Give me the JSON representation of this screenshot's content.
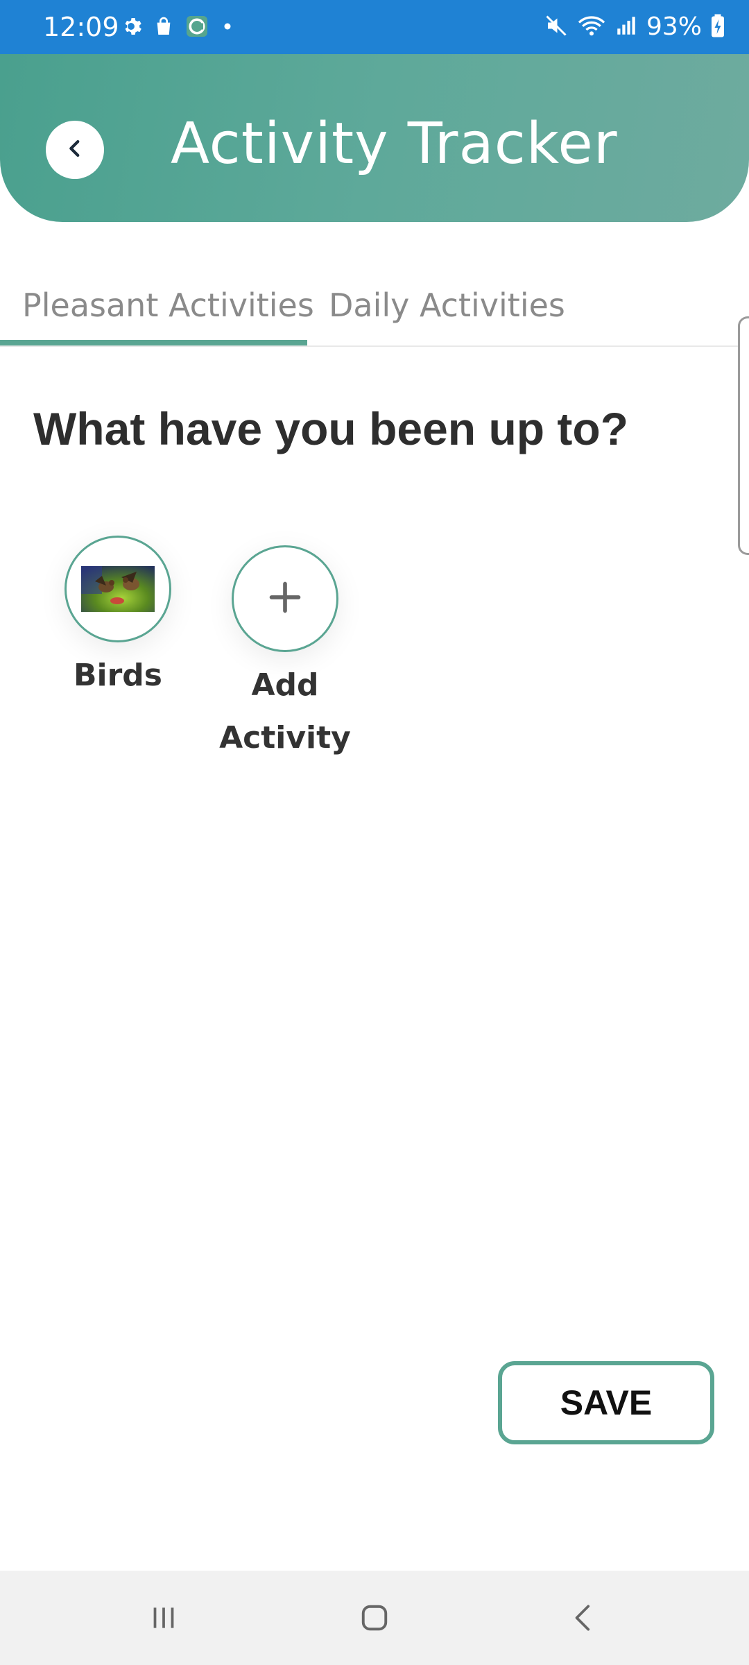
{
  "status_bar": {
    "time": "12:09",
    "battery": "93%",
    "icons": [
      "gear-icon",
      "bag-icon",
      "app-c-icon",
      "dot-icon",
      "mute-icon",
      "wifi-icon",
      "signal-icon",
      "battery-charging-icon"
    ]
  },
  "header": {
    "title": "Activity Tracker",
    "back_icon": "chevron-left-icon",
    "color": "#5aa592"
  },
  "tabs": [
    {
      "label": "Pleasant Activities",
      "selected": true
    },
    {
      "label": "Daily Activities",
      "selected": false
    }
  ],
  "main": {
    "question": "What have you been up to?",
    "activities": [
      {
        "label": "Birds",
        "icon": "birds-photo"
      },
      {
        "label": "Add Activity",
        "icon": "plus-icon"
      }
    ]
  },
  "save_button": {
    "label": "SAVE"
  },
  "nav_bar": {
    "items": [
      "recents-icon",
      "home-icon",
      "back-icon"
    ]
  },
  "colors": {
    "status_bar": "#1f82d4",
    "accent": "#5aa592"
  }
}
